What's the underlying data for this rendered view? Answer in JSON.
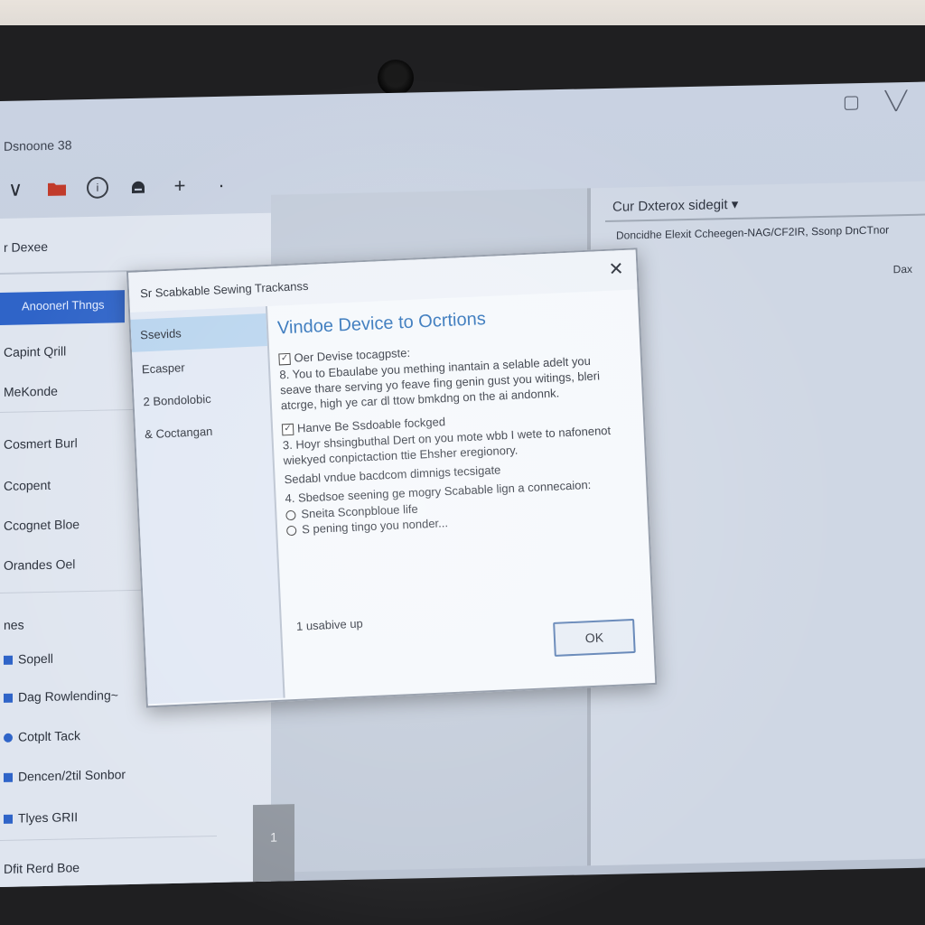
{
  "window": {
    "title": "Dsnoone 38",
    "controls": [
      "▢",
      "╲╱"
    ]
  },
  "toolbar": {
    "icons": [
      "chevron-down-icon",
      "folder-icon",
      "info-icon",
      "lock-icon",
      "plus-icon",
      "dot-icon"
    ],
    "chevron": "∨",
    "plus": "+",
    "dot": "·",
    "info": "i"
  },
  "sidebar": {
    "header": "r Dexee",
    "selected": "Anoonerl Thngs",
    "items": [
      "Capint Qrill",
      "MeKonde",
      "Cosmert Burl",
      "Ccopent",
      "Ccognet Bloe",
      "Orandes Oel",
      "nes",
      "Sopell",
      "Dag Rowlending~",
      "Cotplt Tack",
      "Dencen/2til Sonbor",
      "Tlyes GRII",
      "Dfit Rerd Boe"
    ],
    "scroll_number": "1"
  },
  "right_panel": {
    "dropdown": "Cur Dxterox sidegit ▾",
    "line": "Doncidhe Elexit Ccheegen-NAG/CF2IR, Ssonp DnCTnor",
    "tag": "Dax"
  },
  "dialog": {
    "title": "Sr Scabkable Sewing Trackanss",
    "close": "✕",
    "nav": [
      "Ssevids",
      "Ecasper",
      "2 Bondolobic",
      "& Coctangan"
    ],
    "heading": "Vindoe Device to Ocrtions",
    "section1_label": "Oer Devise tocagpste:",
    "section1_text": "8. You to Ebaulabe you mething inantain a selable adelt you seave thare serving yo feave fing genin gust you witings, bleri atcrge, high ye car dl ttow bmkdng on the ai andonnk.",
    "section2_label": "Hanve Be Ssdoable fockged",
    "section2_text": "3. Hoyr shsingbuthal Dert on you mote wbb I wete to nafonenot wiekyed conpictaction ttie Ehsher eregionory.",
    "step_a": "Sedabl vndue bacdcom dimnigs tecsigate",
    "step_b": "4. Sbedsoe seening ge mogry Scabable lign a connecaion:",
    "radio1": "Sneita Sconpbloue life",
    "radio2": "S pening tingo you nonder...",
    "footnote": "1 usabive up",
    "ok_label": "OK"
  }
}
